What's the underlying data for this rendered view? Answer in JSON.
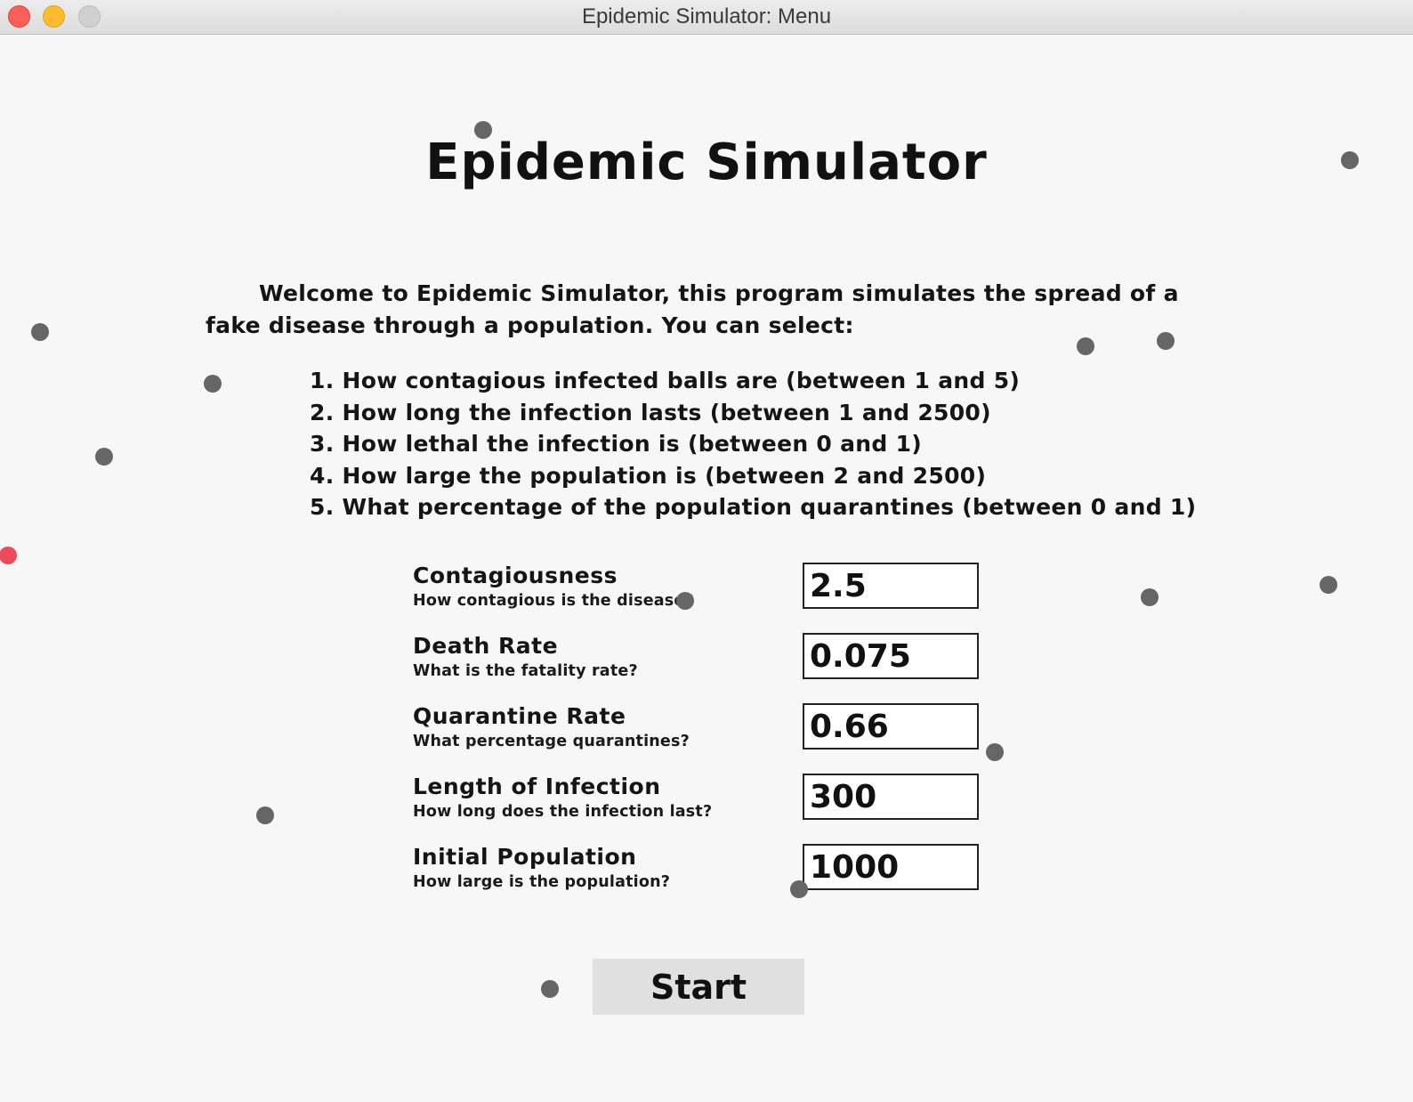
{
  "window": {
    "title": "Epidemic Simulator: Menu"
  },
  "header": {
    "title": "Epidemic Simulator"
  },
  "intro": {
    "text": "Welcome to Epidemic Simulator, this program simulates the spread of a fake disease through a population. You can select:"
  },
  "options": [
    "1. How contagious infected balls are (between 1 and 5)",
    "2. How long the infection lasts (between 1 and 2500)",
    "3. How lethal the infection is (between 0 and 1)",
    "4. How large the population is (between 2 and 2500)",
    "5. What percentage of the population quarantines (between 0 and 1)"
  ],
  "params": [
    {
      "label": "Contagiousness",
      "desc": "How contagious is the disease?",
      "value": "2.5"
    },
    {
      "label": "Death Rate",
      "desc": "What is the fatality rate?",
      "value": "0.075"
    },
    {
      "label": "Quarantine Rate",
      "desc": "What percentage quarantines?",
      "value": "0.66"
    },
    {
      "label": "Length of Infection",
      "desc": "How long does the infection last?",
      "value": "300"
    },
    {
      "label": "Initial Population",
      "desc": "How large is the population?",
      "value": "1000"
    }
  ],
  "start_button": {
    "label": "Start"
  },
  "colors": {
    "healthy_ball": "#666666",
    "infected_ball": "#ef4a5a",
    "background": "#f7f7f7"
  }
}
